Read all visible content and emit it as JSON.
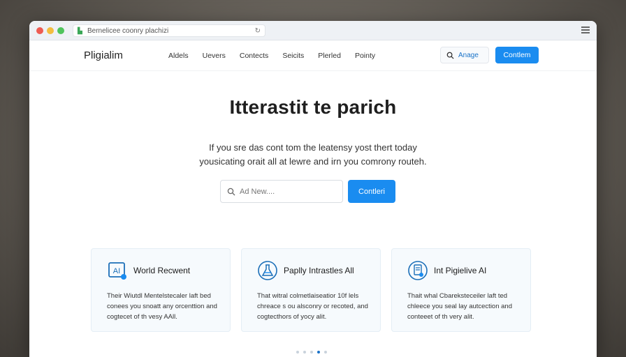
{
  "browser": {
    "url": "Bernelicee coonry plachizi",
    "reload_glyph": "↻",
    "lock_glyph": "▙"
  },
  "nav": {
    "brand": "Pligialim",
    "links": [
      "Aldels",
      "Uevers",
      "Contects",
      "Seicits",
      "Plerled",
      "Pointy"
    ],
    "search_label": "Anage",
    "cta_label": "Contlem"
  },
  "hero": {
    "title": "Itterastit te parich",
    "subtitle_line1": "If you sre das cont tom the leatensy yost thert today",
    "subtitle_line2": "yousicating orait all at lewre and irn you comrony routeh.",
    "search_placeholder": "Ad New....",
    "cta_label": "Contleri"
  },
  "cards": [
    {
      "icon": "ai-chip-icon",
      "title": "World Recwent",
      "lines": [
        "Their Wiutdl Mentelstecaler laft bed",
        "conees you snoatt any orcenttion and",
        "cogtecet of th vesy AAll."
      ]
    },
    {
      "icon": "flask-icon",
      "title": "Paplly Intrastles All",
      "lines": [
        "That witral colmetlaiseatior 10f lels",
        "chreace s ou alsconry or recoted, and",
        "cogtecthors of yocy alit."
      ]
    },
    {
      "icon": "document-gear-icon",
      "title": "Int Pigielive AI",
      "lines": [
        "Thait whal Cbareksteceiler laft ted",
        "chleece you seal lay autcection and",
        "conteeet of th very alit."
      ]
    }
  ],
  "pager": {
    "count": 5,
    "active_index": 3
  },
  "colors": {
    "accent": "#1a8cf0",
    "link": "#1a73c8"
  }
}
